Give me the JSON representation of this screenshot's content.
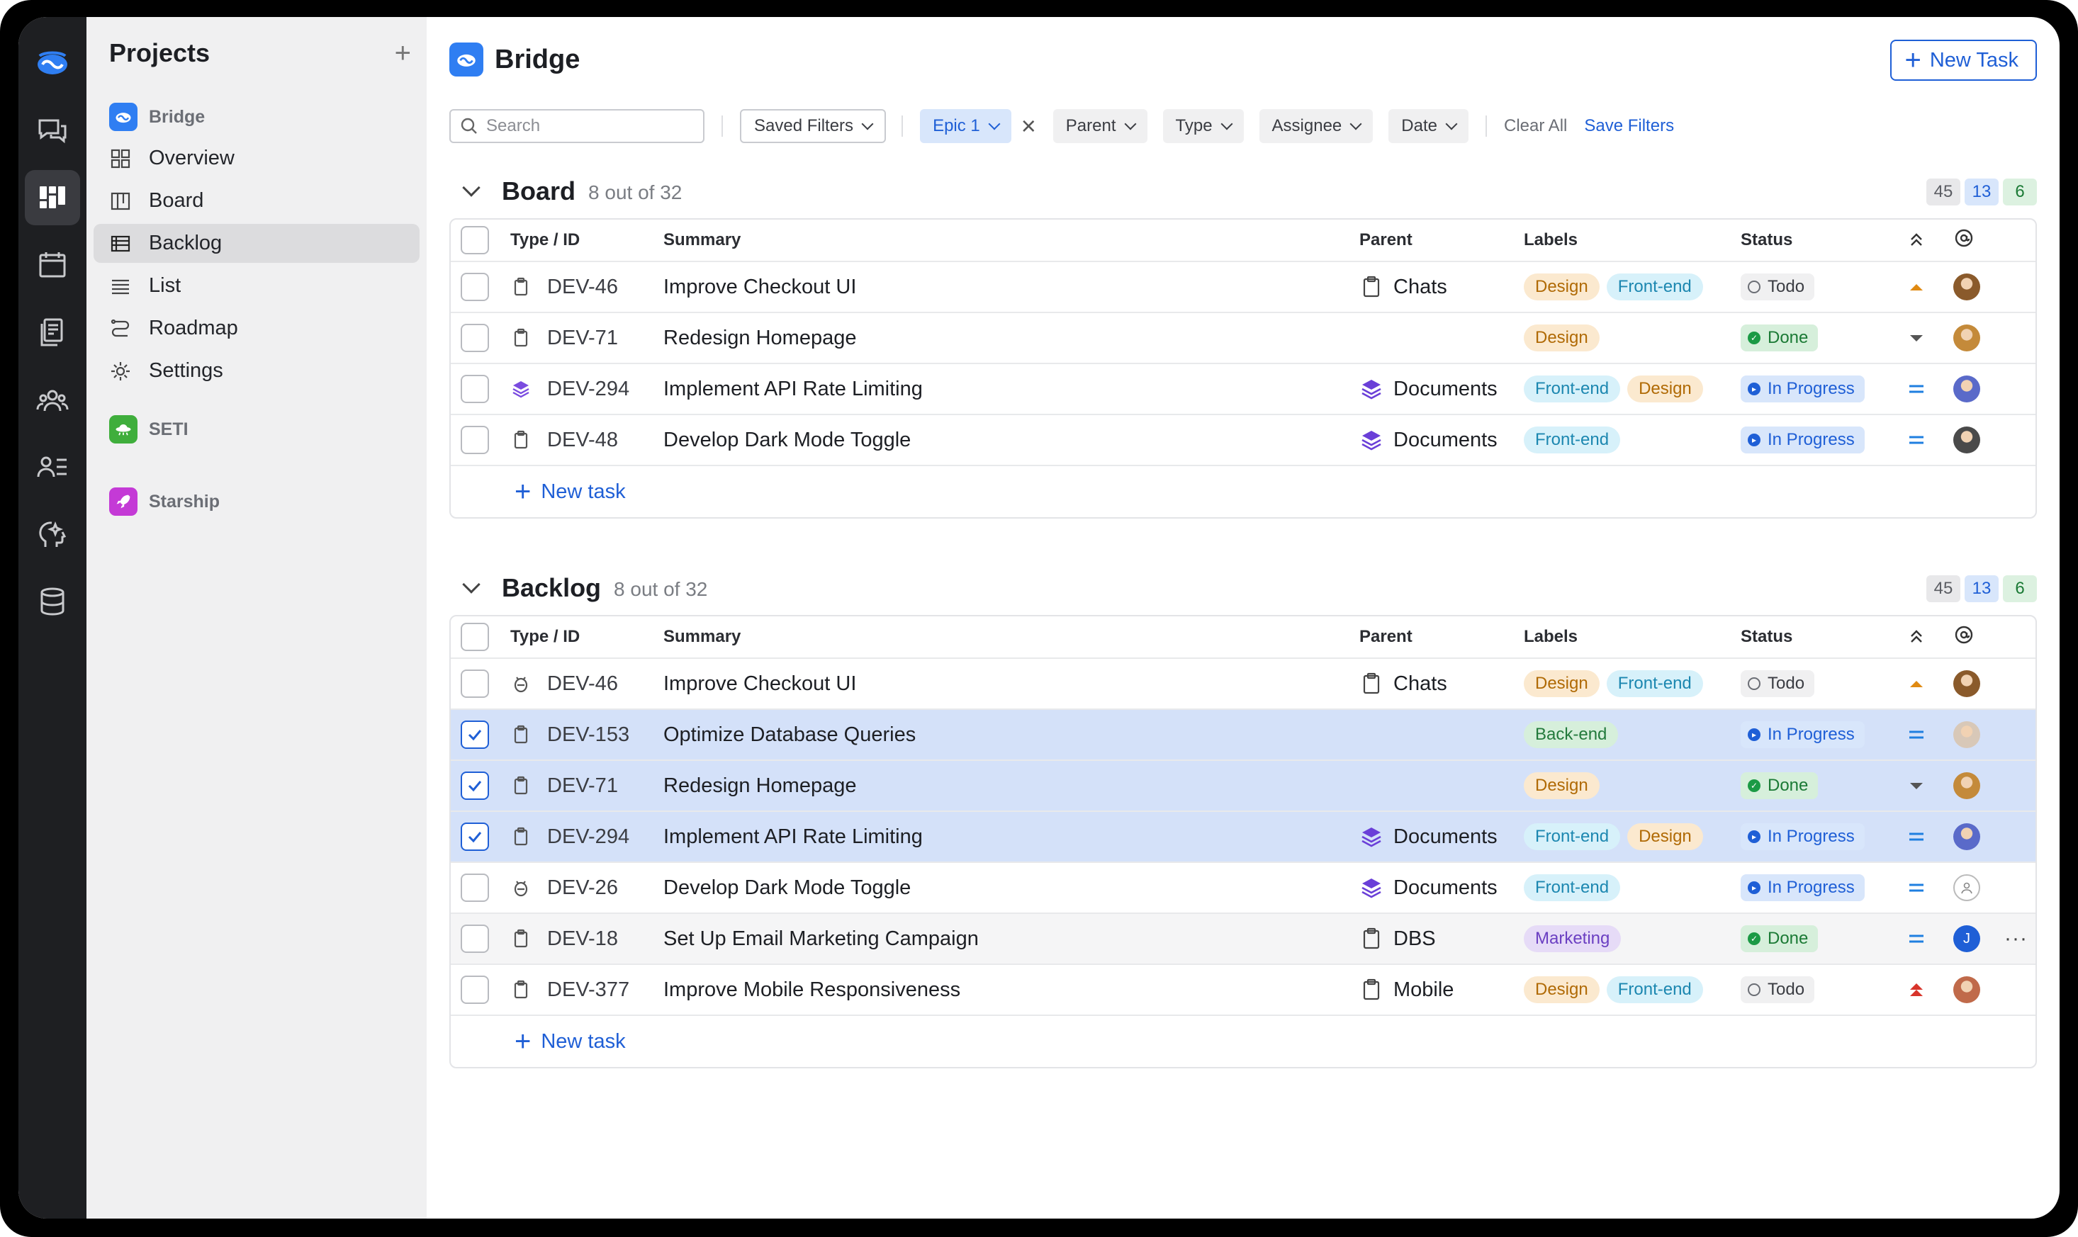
{
  "sidebar": {
    "title": "Projects",
    "add_label": "+"
  },
  "projects": [
    {
      "name": "Bridge",
      "color": "#1f5fd6"
    },
    {
      "name": "SETI",
      "color": "#3fae3c"
    },
    {
      "name": "Starship",
      "color": "#c43ad6"
    }
  ],
  "nav": [
    {
      "label": "Overview",
      "icon": "grid-icon"
    },
    {
      "label": "Board",
      "icon": "board-icon"
    },
    {
      "label": "Backlog",
      "icon": "backlog-icon"
    },
    {
      "label": "List",
      "icon": "list-icon"
    },
    {
      "label": "Roadmap",
      "icon": "roadmap-icon"
    },
    {
      "label": "Settings",
      "icon": "gear-icon"
    }
  ],
  "header": {
    "title": "Bridge",
    "new_task": "New Task"
  },
  "filters": {
    "search_placeholder": "Search",
    "saved": "Saved Filters",
    "epic": "Epic 1",
    "parent": "Parent",
    "type": "Type",
    "assignee": "Assignee",
    "date": "Date",
    "clear": "Clear All",
    "save": "Save Filters"
  },
  "columns": {
    "type_id": "Type / ID",
    "summary": "Summary",
    "parent": "Parent",
    "labels": "Labels",
    "status": "Status"
  },
  "board": {
    "title": "Board",
    "count": "8 out of 32",
    "counts": [
      "45",
      "13",
      "6"
    ],
    "add": "New task",
    "rows": [
      {
        "id": "DEV-46",
        "type": "task",
        "summary": "Improve Checkout UI",
        "parent": "Chats",
        "parent_icon": "clipboard",
        "labels": [
          "Design",
          "Front-end"
        ],
        "status": "Todo",
        "priority": "medium-up",
        "avatar": "#8a5a2b",
        "selected": false
      },
      {
        "id": "DEV-71",
        "type": "task",
        "summary": "Redesign Homepage",
        "parent": "",
        "parent_icon": "",
        "labels": [
          "Design"
        ],
        "status": "Done",
        "priority": "low-down",
        "avatar": "#c48a3a",
        "selected": false
      },
      {
        "id": "DEV-294",
        "type": "epic",
        "summary": "Implement API Rate Limiting",
        "parent": "Documents",
        "parent_icon": "stack",
        "labels": [
          "Front-end",
          "Design"
        ],
        "status": "In Progress",
        "priority": "equal",
        "avatar": "#5a6ac9",
        "selected": false
      },
      {
        "id": "DEV-48",
        "type": "task",
        "summary": "Develop Dark Mode Toggle",
        "parent": "Documents",
        "parent_icon": "stack",
        "labels": [
          "Front-end"
        ],
        "status": "In Progress",
        "priority": "equal",
        "avatar": "#4a4a4a",
        "selected": false
      }
    ]
  },
  "backlog": {
    "title": "Backlog",
    "count": "8 out of 32",
    "counts": [
      "45",
      "13",
      "6"
    ],
    "add": "New task",
    "rows": [
      {
        "id": "DEV-46",
        "type": "bug",
        "summary": "Improve Checkout UI",
        "parent": "Chats",
        "parent_icon": "clipboard",
        "labels": [
          "Design",
          "Front-end"
        ],
        "status": "Todo",
        "priority": "medium-up",
        "avatar": "#8a5a2b",
        "selected": false
      },
      {
        "id": "DEV-153",
        "type": "task",
        "summary": "Optimize Database Queries",
        "parent": "",
        "parent_icon": "",
        "labels": [
          "Back-end"
        ],
        "status": "In Progress",
        "priority": "equal",
        "avatar": "#d8c8b8",
        "selected": true
      },
      {
        "id": "DEV-71",
        "type": "task",
        "summary": "Redesign Homepage",
        "parent": "",
        "parent_icon": "",
        "labels": [
          "Design"
        ],
        "status": "Done",
        "priority": "low-down",
        "avatar": "#c48a3a",
        "selected": true
      },
      {
        "id": "DEV-294",
        "type": "task",
        "summary": "Implement API Rate Limiting",
        "parent": "Documents",
        "parent_icon": "stack",
        "labels": [
          "Front-end",
          "Design"
        ],
        "status": "In Progress",
        "priority": "equal",
        "avatar": "#5a6ac9",
        "selected": true
      },
      {
        "id": "DEV-26",
        "type": "bug",
        "summary": "Develop Dark Mode Toggle",
        "parent": "Documents",
        "parent_icon": "stack",
        "labels": [
          "Front-end"
        ],
        "status": "In Progress",
        "priority": "equal",
        "avatar": "empty",
        "selected": false
      },
      {
        "id": "DEV-18",
        "type": "task",
        "summary": "Set Up Email Marketing Campaign",
        "parent": "DBS",
        "parent_icon": "clipboard",
        "labels": [
          "Marketing"
        ],
        "status": "Done",
        "priority": "equal",
        "avatar": "J",
        "selected": false,
        "hover": true,
        "more": "···"
      },
      {
        "id": "DEV-377",
        "type": "task",
        "summary": "Improve Mobile Responsiveness",
        "parent": "Mobile",
        "parent_icon": "clipboard",
        "labels": [
          "Design",
          "Front-end"
        ],
        "status": "Todo",
        "priority": "high-up",
        "avatar": "#c06a4a",
        "selected": false
      }
    ]
  }
}
